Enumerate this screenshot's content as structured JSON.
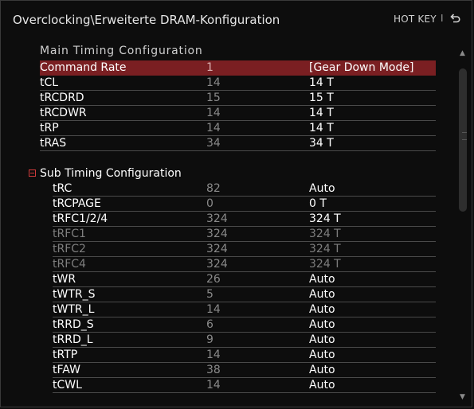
{
  "header": {
    "breadcrumb": "Overclocking\\Erweiterte DRAM-Konfiguration",
    "hotkey_label": "HOT KEY",
    "separator": "I"
  },
  "main_timing": {
    "title": "Main Timing Configuration",
    "rows": [
      {
        "name": "Command Rate",
        "current": "1",
        "value": "[Gear Down Mode]"
      },
      {
        "name": "tCL",
        "current": "14",
        "value": "14 T"
      },
      {
        "name": "tRCDRD",
        "current": "15",
        "value": "15 T"
      },
      {
        "name": "tRCDWR",
        "current": "14",
        "value": "14 T"
      },
      {
        "name": "tRP",
        "current": "14",
        "value": "14 T"
      },
      {
        "name": "tRAS",
        "current": "34",
        "value": "34 T"
      }
    ]
  },
  "sub_timing": {
    "title": "Sub Timing Configuration",
    "rows": [
      {
        "name": "tRC",
        "current": "82",
        "value": "Auto"
      },
      {
        "name": "tRCPAGE",
        "current": "0",
        "value": "0 T"
      },
      {
        "name": "tRFC1/2/4",
        "current": "324",
        "value": "324 T"
      },
      {
        "name": "tRFC1",
        "current": "324",
        "value": "324 T"
      },
      {
        "name": "tRFC2",
        "current": "324",
        "value": "324 T"
      },
      {
        "name": "tRFC4",
        "current": "324",
        "value": "324 T"
      },
      {
        "name": "tWR",
        "current": "26",
        "value": "Auto"
      },
      {
        "name": "tWTR_S",
        "current": "5",
        "value": "Auto"
      },
      {
        "name": "tWTR_L",
        "current": "14",
        "value": "Auto"
      },
      {
        "name": "tRRD_S",
        "current": "6",
        "value": "Auto"
      },
      {
        "name": "tRRD_L",
        "current": "9",
        "value": "Auto"
      },
      {
        "name": "tRTP",
        "current": "14",
        "value": "Auto"
      },
      {
        "name": "tFAW",
        "current": "38",
        "value": "Auto"
      },
      {
        "name": "tCWL",
        "current": "14",
        "value": "Auto"
      }
    ]
  },
  "colors": {
    "highlight": "#7a1f22",
    "accent_red": "#d23b3b",
    "disabled_text": "#7e7e7e"
  },
  "icons": {
    "back": "back-arrow-icon",
    "collapse": "collapse-minus-icon",
    "scroll_up": "scroll-up-icon",
    "scroll_down": "scroll-down-icon"
  }
}
